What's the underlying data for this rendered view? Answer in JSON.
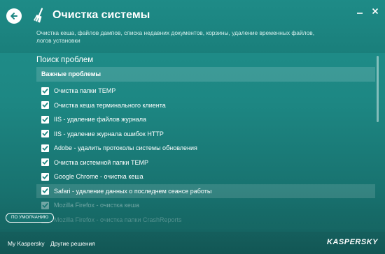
{
  "header": {
    "title": "Очистка системы",
    "subtitle": "Очистка кеша, файлов дампов, списка недавних документов, корзины, удаление временных файлов, логов установки",
    "icon": "broom-icon"
  },
  "main": {
    "section_title": "Поиск проблем",
    "group_title": "Важные проблемы",
    "items": [
      {
        "label": "Очистка папки TEMP",
        "checked": true
      },
      {
        "label": "Очистка кеша терминального клиента",
        "checked": true
      },
      {
        "label": "IIS - удаление файлов журнала",
        "checked": true
      },
      {
        "label": "IIS - удаление журнала ошибок HTTP",
        "checked": true
      },
      {
        "label": "Adobe - удалить протоколы системы обновления",
        "checked": true
      },
      {
        "label": "Очистка системной папки TEMP",
        "checked": true
      },
      {
        "label": "Google Chrome - очистка кеша",
        "checked": true
      },
      {
        "label": "Safari - удаление данных о последнем сеансе работы",
        "checked": true,
        "selected": true
      },
      {
        "label": "Mozilla Firefox - очистка кеша",
        "checked": true
      },
      {
        "label": "Mozilla Firefox - очистка папки CrashReports",
        "checked": true
      }
    ],
    "default_button": "ПО УМОЛЧАНИЮ"
  },
  "footer": {
    "my_kaspersky": "My Kaspersky",
    "other_solutions": "Другие решения",
    "brand": "KASPERSKY"
  },
  "colors": {
    "background": "#1d8783",
    "footer": "#135a58",
    "text": "#ffffff"
  }
}
